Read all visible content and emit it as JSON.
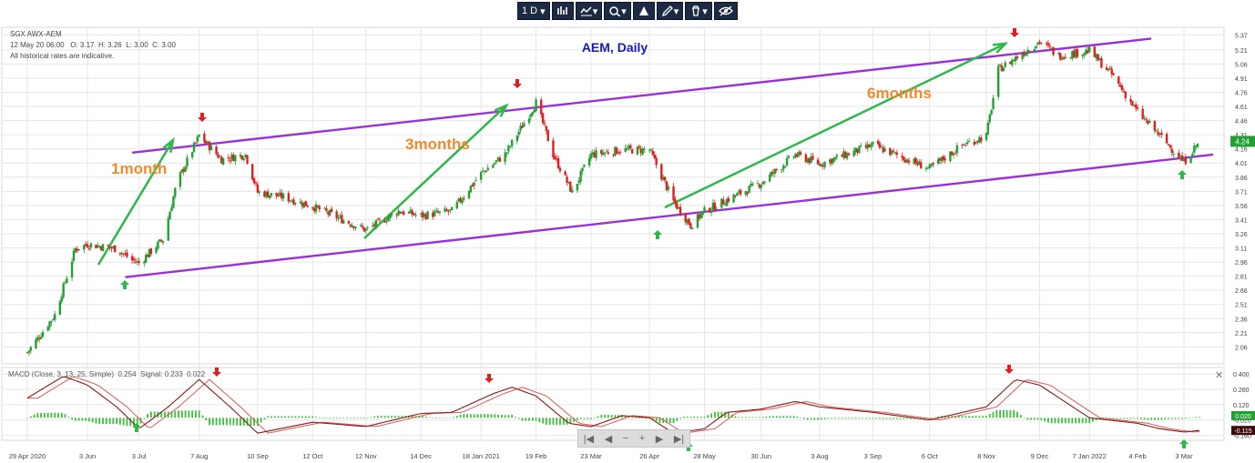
{
  "toolbar": {
    "interval_label": "1 D",
    "icons": [
      "chart-type-icon",
      "indicator-icon",
      "compare-icon",
      "drawing-tool-icon",
      "pen-icon",
      "trash-icon",
      "visibility-icon"
    ]
  },
  "header": {
    "symbol": "SGX AWX-AEM",
    "ohlc_line": "12 May 20 06:00   O: 3.17  H: 3.26  L: 3.00  C: 3.00",
    "disclaimer": "All historical rates are indicative."
  },
  "macd_header": {
    "label": "MACD (Close, 3, 13, 25, Simple)",
    "value": "0.254",
    "signal_label": "Signal:",
    "signal_value": "0.233",
    "hist_value": "0.022"
  },
  "colors": {
    "up_candle": "#23a034",
    "down_candle": "#e02020",
    "channel": "#9b30d9",
    "trend_arrow": "#2eb84a",
    "annotation_text": "#f08a2c",
    "title_text": "#1818c8",
    "macd_line": "#8b1a1a",
    "signal_line": "#e05858",
    "histogram": "#3cc03c"
  },
  "chart_data": {
    "type": "candlestick",
    "title": "AEM, Daily",
    "price_axis": {
      "ticks": [
        "5.37",
        "5.21",
        "5.06",
        "4.91",
        "4.76",
        "4.61",
        "4.46",
        "4.31",
        "4.16",
        "4.01",
        "3.86",
        "3.71",
        "3.56",
        "3.41",
        "3.26",
        "3.11",
        "2.96",
        "2.81",
        "2.66",
        "2.51",
        "2.36",
        "2.21",
        "2.06"
      ],
      "last_price_label": "4.24"
    },
    "macd_axis": {
      "ticks": [
        "0.400",
        "0.260",
        "0.120",
        "-0.020",
        "-0.160"
      ],
      "signal_label": "0.020",
      "macd_label": "-0.115"
    },
    "x_ticks": [
      "29 Apr 2020",
      "3 Jun",
      "3 Jul",
      "7 Aug",
      "10 Sep",
      "12 Oct",
      "12 Nov",
      "14 Dec",
      "18 Jan 2021",
      "19 Feb",
      "23 Mar",
      "26 Apr",
      "28 May",
      "30 Jun",
      "3 Aug",
      "3 Sep",
      "6 Oct",
      "8 Nov",
      "9 Dec",
      "7 Jan 2022",
      "4 Feb",
      "3 Mar"
    ],
    "price_path": [
      {
        "date": "29 Apr 2020",
        "price": 2.0
      },
      {
        "date": "15 May",
        "price": 2.4
      },
      {
        "date": "27 May",
        "price": 3.1
      },
      {
        "date": "3 Jun",
        "price": 3.15
      },
      {
        "date": "20 Jun",
        "price": 3.1
      },
      {
        "date": "29 Jun",
        "price": 2.98
      },
      {
        "date": "3 Jul",
        "price": 2.95
      },
      {
        "date": "17 Jul",
        "price": 3.2
      },
      {
        "date": "25 Jul",
        "price": 3.8
      },
      {
        "date": "7 Aug",
        "price": 4.3
      },
      {
        "date": "20 Aug",
        "price": 4.05
      },
      {
        "date": "3 Sep",
        "price": 4.1
      },
      {
        "date": "10 Sep",
        "price": 3.7
      },
      {
        "date": "25 Sep",
        "price": 3.65
      },
      {
        "date": "12 Oct",
        "price": 3.55
      },
      {
        "date": "12 Nov",
        "price": 3.3
      },
      {
        "date": "1 Dec",
        "price": 3.5
      },
      {
        "date": "14 Dec",
        "price": 3.45
      },
      {
        "date": "1 Jan 2021",
        "price": 3.5
      },
      {
        "date": "18 Jan 2021",
        "price": 3.9
      },
      {
        "date": "1 Feb",
        "price": 4.1
      },
      {
        "date": "19 Feb",
        "price": 4.65
      },
      {
        "date": "1 Mar",
        "price": 4.1
      },
      {
        "date": "12 Mar",
        "price": 3.7
      },
      {
        "date": "23 Mar",
        "price": 4.1
      },
      {
        "date": "10 Apr",
        "price": 4.15
      },
      {
        "date": "26 Apr",
        "price": 4.15
      },
      {
        "date": "10 May",
        "price": 3.6
      },
      {
        "date": "20 May",
        "price": 3.35
      },
      {
        "date": "28 May",
        "price": 3.5
      },
      {
        "date": "30 Jun",
        "price": 3.8
      },
      {
        "date": "20 Jul",
        "price": 4.1
      },
      {
        "date": "3 Aug",
        "price": 4.0
      },
      {
        "date": "3 Sep",
        "price": 4.2
      },
      {
        "date": "6 Oct",
        "price": 3.95
      },
      {
        "date": "25 Oct",
        "price": 4.2
      },
      {
        "date": "8 Nov",
        "price": 4.3
      },
      {
        "date": "15 Nov",
        "price": 5.0
      },
      {
        "date": "9 Dec",
        "price": 5.3
      },
      {
        "date": "20 Dec",
        "price": 5.15
      },
      {
        "date": "7 Jan 2022",
        "price": 5.2
      },
      {
        "date": "20 Jan",
        "price": 4.95
      },
      {
        "date": "4 Feb",
        "price": 4.55
      },
      {
        "date": "17 Feb",
        "price": 4.3
      },
      {
        "date": "3 Mar",
        "price": 4.02
      },
      {
        "date": "12 Mar",
        "price": 4.24
      }
    ],
    "macd_series": [
      {
        "date": "29 Apr 2020",
        "macd": 0.18
      },
      {
        "date": "20 May",
        "macd": 0.38
      },
      {
        "date": "3 Jun",
        "macd": 0.3
      },
      {
        "date": "20 Jun",
        "macd": 0.1
      },
      {
        "date": "3 Jul",
        "macd": -0.1
      },
      {
        "date": "20 Jul",
        "macd": 0.1
      },
      {
        "date": "7 Aug",
        "macd": 0.35
      },
      {
        "date": "25 Aug",
        "macd": 0.1
      },
      {
        "date": "10 Sep",
        "macd": -0.14
      },
      {
        "date": "12 Oct",
        "macd": -0.04
      },
      {
        "date": "12 Nov",
        "macd": -0.08
      },
      {
        "date": "14 Dec",
        "macd": 0.04
      },
      {
        "date": "1 Jan 2021",
        "macd": 0.05
      },
      {
        "date": "25 Jan",
        "macd": 0.22
      },
      {
        "date": "5 Feb",
        "macd": 0.28
      },
      {
        "date": "19 Feb",
        "macd": 0.2
      },
      {
        "date": "10 Mar",
        "macd": -0.05
      },
      {
        "date": "23 Mar",
        "macd": -0.08
      },
      {
        "date": "10 Apr",
        "macd": 0.02
      },
      {
        "date": "26 Apr",
        "macd": 0.0
      },
      {
        "date": "10 May",
        "macd": -0.14
      },
      {
        "date": "28 May",
        "macd": -0.1
      },
      {
        "date": "10 Jun",
        "macd": 0.05
      },
      {
        "date": "30 Jun",
        "macd": 0.08
      },
      {
        "date": "20 Jul",
        "macd": 0.15
      },
      {
        "date": "3 Aug",
        "macd": 0.1
      },
      {
        "date": "3 Sep",
        "macd": 0.05
      },
      {
        "date": "6 Oct",
        "macd": -0.02
      },
      {
        "date": "8 Nov",
        "macd": 0.1
      },
      {
        "date": "25 Nov",
        "macd": 0.35
      },
      {
        "date": "9 Dec",
        "macd": 0.3
      },
      {
        "date": "7 Jan 2022",
        "macd": 0.0
      },
      {
        "date": "4 Feb",
        "macd": -0.05
      },
      {
        "date": "17 Feb",
        "macd": -0.1
      },
      {
        "date": "3 Mar",
        "macd": -0.13
      },
      {
        "date": "12 Mar",
        "macd": -0.115
      }
    ],
    "channel_lines": {
      "upper": [
        {
          "date": "29 Jun",
          "price": 4.12
        },
        {
          "date": "12 Feb 2022",
          "price": 5.33
        }
      ],
      "lower": [
        {
          "date": "25 Jun",
          "price": 2.8
        },
        {
          "date": "20 Mar 2022",
          "price": 4.1
        }
      ]
    },
    "annotations": [
      {
        "text": "1month",
        "anchor_date": "3 Jul"
      },
      {
        "text": "3months",
        "anchor_date": "30 Dec"
      },
      {
        "text": "6months",
        "anchor_date": "20 Sep"
      }
    ],
    "signal_arrows": [
      {
        "direction": "up",
        "date": "3 Jul"
      },
      {
        "direction": "down",
        "date": "7 Aug"
      },
      {
        "direction": "down",
        "date": "19 Feb"
      },
      {
        "direction": "up",
        "date": "20 May"
      },
      {
        "direction": "down",
        "date": "9 Dec"
      },
      {
        "direction": "up",
        "date": "3 Mar"
      }
    ],
    "grid": true,
    "subplots": [
      "price",
      "MACD"
    ]
  },
  "navigator": {
    "buttons": [
      "|◀",
      "◀",
      "−",
      "+",
      "▶",
      "▶|"
    ]
  }
}
